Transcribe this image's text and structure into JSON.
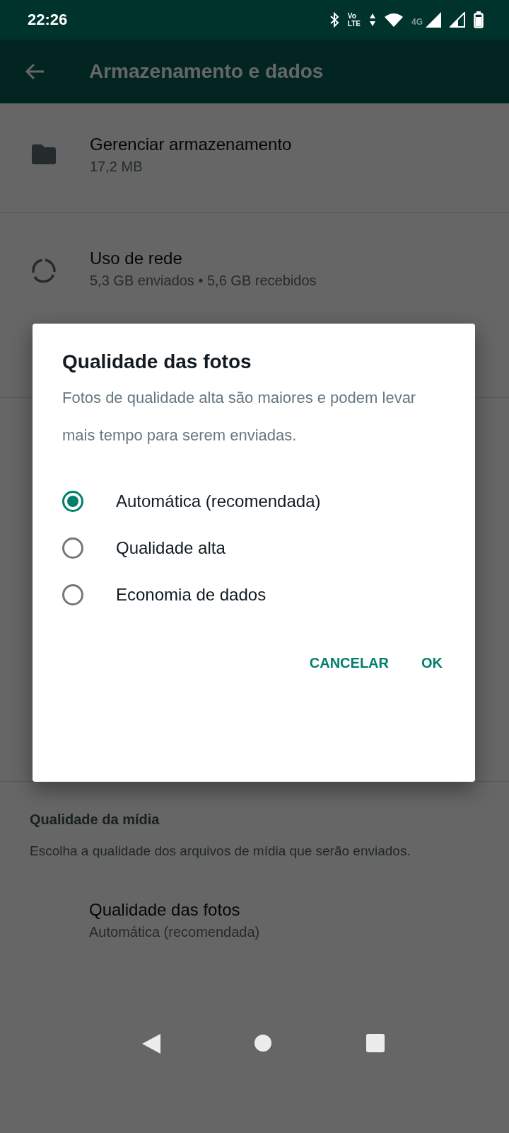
{
  "status_bar": {
    "time": "22:26",
    "volte_top": "Vo",
    "volte_bottom": "LTE",
    "network": "4G"
  },
  "app_bar": {
    "title": "Armazenamento e dados"
  },
  "settings": [
    {
      "kind": "folder",
      "title": "Gerenciar armazenamento",
      "subtitle": "17,2 MB"
    },
    {
      "kind": "network",
      "title": "Uso de rede",
      "subtitle": "5,3 GB enviados • 5,6 GB recebidos"
    }
  ],
  "media_section": {
    "heading": "Qualidade da mídia",
    "description": "Escolha a qualidade dos arquivos de mídia que serão enviados.",
    "items": [
      {
        "title": "Qualidade das fotos",
        "subtitle": "Automática (recomendada)"
      }
    ]
  },
  "dialog": {
    "title": "Qualidade das fotos",
    "message": "Fotos de qualidade alta são maiores e podem levar mais tempo para serem enviadas.",
    "options": [
      {
        "label": "Automática (recomendada)",
        "selected": true
      },
      {
        "label": "Qualidade alta",
        "selected": false
      },
      {
        "label": "Economia de dados",
        "selected": false
      }
    ],
    "buttons": [
      {
        "label": "CANCELAR"
      },
      {
        "label": "OK"
      }
    ]
  }
}
